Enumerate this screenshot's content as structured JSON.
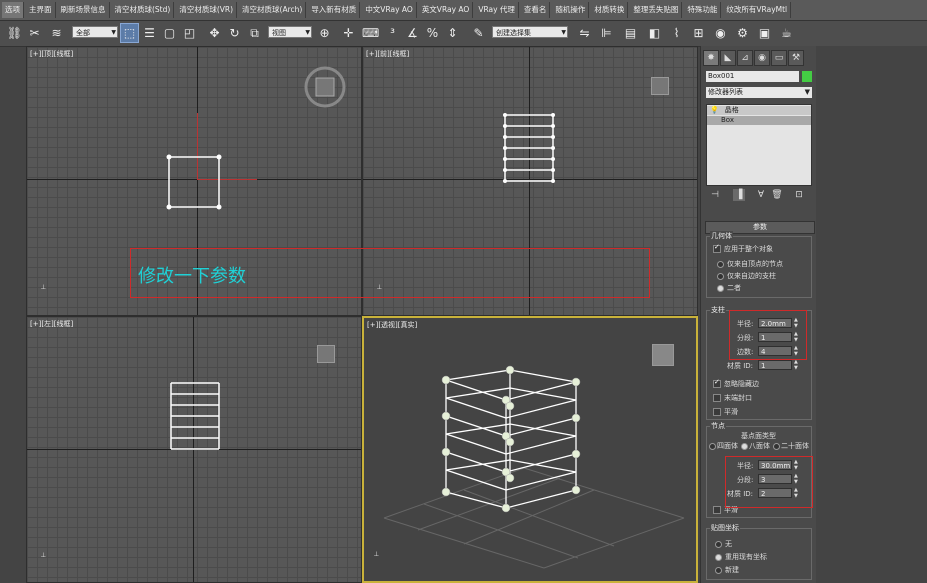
{
  "menubar": {
    "items": [
      "选项",
      "主界面",
      "刷新场景信息",
      "清空材质球(Std)",
      "清空材质球(VR)",
      "清空材质球(Arch)",
      "导入新有材质",
      "中文VRay AO",
      "英文VRay AO",
      "VRay 代理",
      "查看名",
      "随机操作",
      "材质转换",
      "整理丢失贴图",
      "特殊功能",
      "纹改所有VRayMtl"
    ]
  },
  "toolbar": {
    "selection_filter": "全部",
    "ref_coord": "视图",
    "named_selection": "创建选择集"
  },
  "viewports": {
    "top": {
      "label": "[+][顶][线框]"
    },
    "front": {
      "label": "[+][前][线框]"
    },
    "left": {
      "label": "[+][左][线框]"
    },
    "persp": {
      "label": "[+][透视][真实]"
    },
    "annotation": "修改一下参数"
  },
  "cmd_panel": {
    "object_name": "Box001",
    "object_color": "#44cc44",
    "modifier_list": "修改器列表",
    "stack": [
      "晶格",
      "Box"
    ],
    "params_title": "参数",
    "geometry": {
      "title": "几何体",
      "apply_whole": "应用于整个对象",
      "opt_joints": "仅来自顶点的节点",
      "opt_struts": "仅来自边的支柱",
      "opt_both": "二者"
    },
    "struts": {
      "title": "支柱",
      "radius_label": "半径:",
      "radius_value": "2.0mm",
      "segments_label": "分段:",
      "segments_value": "1",
      "sides_label": "边数:",
      "sides_value": "4",
      "matid_label": "材质 ID:",
      "matid_value": "1",
      "ignore_hidden": "忽略隐藏边",
      "end_caps": "末端封口",
      "smooth": "平滑"
    },
    "joints": {
      "title": "节点",
      "type_title": "基点面类型",
      "tetra": "四面体",
      "octa": "八面体",
      "icosa": "二十面体",
      "radius_label": "半径:",
      "radius_value": "30.0mm",
      "segments_label": "分段:",
      "segments_value": "3",
      "matid_label": "材质 ID:",
      "matid_value": "2",
      "smooth": "平滑"
    },
    "mapping": {
      "title": "贴图坐标",
      "none": "无",
      "reuse": "重用现有坐标",
      "new": "新建"
    }
  }
}
